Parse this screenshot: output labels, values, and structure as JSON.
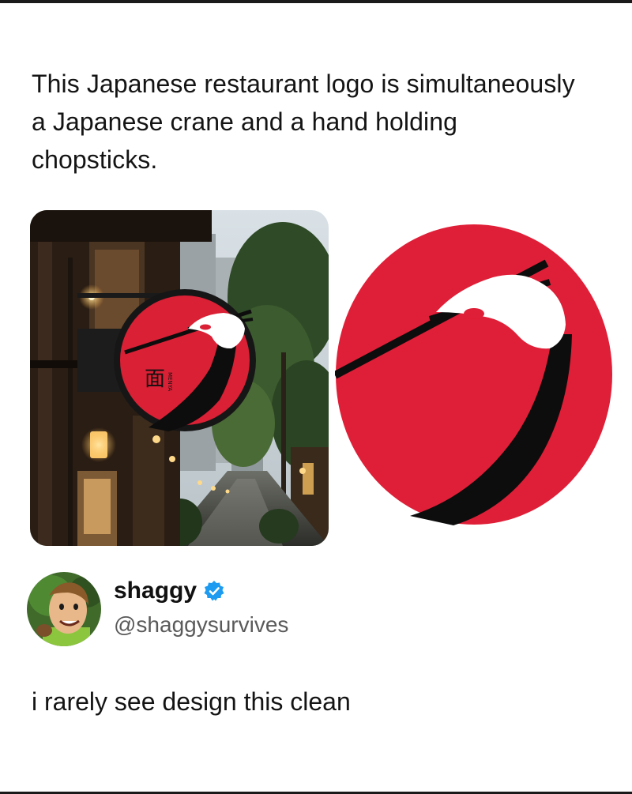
{
  "caption": "This Japanese restaurant logo is simultaneously a Japanese crane and a hand holding chopsticks.",
  "sign": {
    "kanji": "面",
    "latin": "MENYA"
  },
  "author": {
    "name": "shaggy",
    "handle": "@shaggysurvives",
    "verified": true
  },
  "post": {
    "text": "i rarely see design this clean"
  },
  "colors": {
    "logo_red": "#df1f37",
    "crane_black": "#0d0d0d",
    "verified_blue": "#1d9bf0"
  },
  "icons": [
    "verified-badge-icon",
    "wall-lamp-icon",
    "lantern-icon"
  ]
}
